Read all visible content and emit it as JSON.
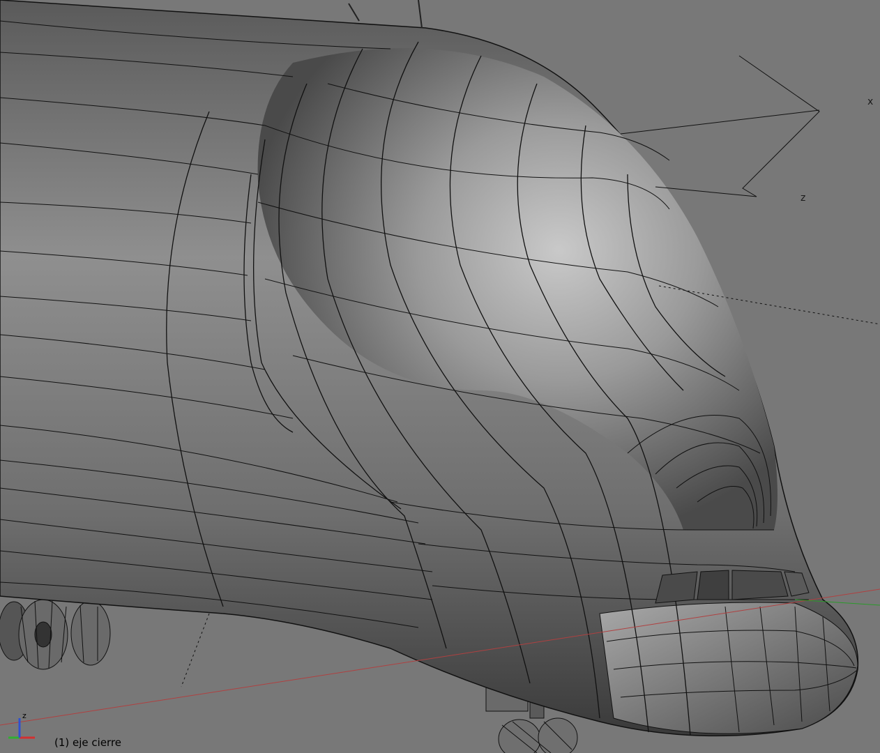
{
  "viewport": {
    "background": "#787878",
    "object_label": "(1) eje cierre",
    "gizmo_axes": {
      "x": "x",
      "z": "z"
    },
    "corner_axes": {
      "up": "z",
      "colors": {
        "x": "#d23030",
        "y": "#30b030",
        "z": "#3050d0"
      }
    }
  },
  "scene": {
    "subject": "airplane-nose-mesh",
    "mesh_color": "#8a8a8a",
    "wire_color": "#111111",
    "ground_line_color": "#b04040",
    "axis_line_color": "#2a9a2a"
  }
}
